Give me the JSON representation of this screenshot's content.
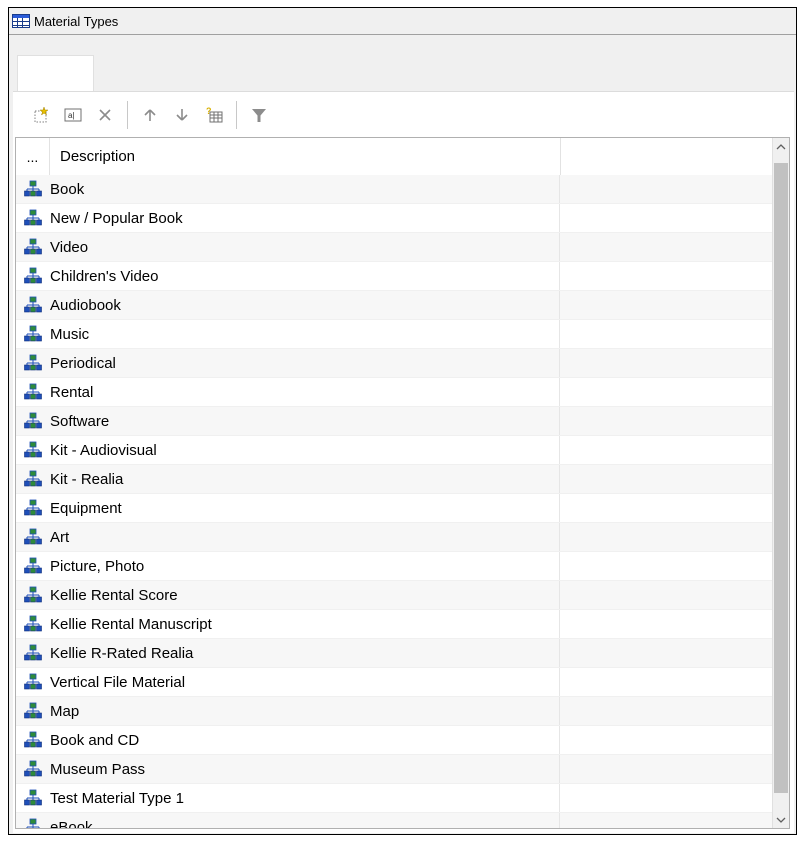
{
  "window": {
    "title": "Material Types"
  },
  "tab": {
    "label": ""
  },
  "toolbar": {
    "icons": [
      "new-record-icon",
      "rename-icon",
      "delete-icon",
      "move-up-icon",
      "move-down-icon",
      "new-from-template-icon",
      "filter-icon"
    ]
  },
  "grid": {
    "selector_header": "...",
    "description_header": "Description",
    "rows": [
      "Book",
      "New / Popular Book",
      "Video",
      "Children's Video",
      "Audiobook",
      "Music",
      "Periodical",
      "Rental",
      "Software",
      "Kit - Audiovisual",
      "Kit - Realia",
      "Equipment",
      "Art",
      "Picture, Photo",
      "Kellie Rental Score",
      "Kellie Rental Manuscript",
      "Kellie R-Rated Realia",
      "Vertical File Material",
      "Map",
      "Book and CD",
      "Museum Pass",
      "Test Material Type 1",
      "eBook"
    ]
  },
  "scrollbar": {
    "up_arrow": "^",
    "down_arrow": "v"
  },
  "colors": {
    "icon_blue": "#1f4fb8",
    "icon_green": "#2e8b3a",
    "grid_border": "#b0b0b0",
    "stripe": "#f7f7f7"
  }
}
